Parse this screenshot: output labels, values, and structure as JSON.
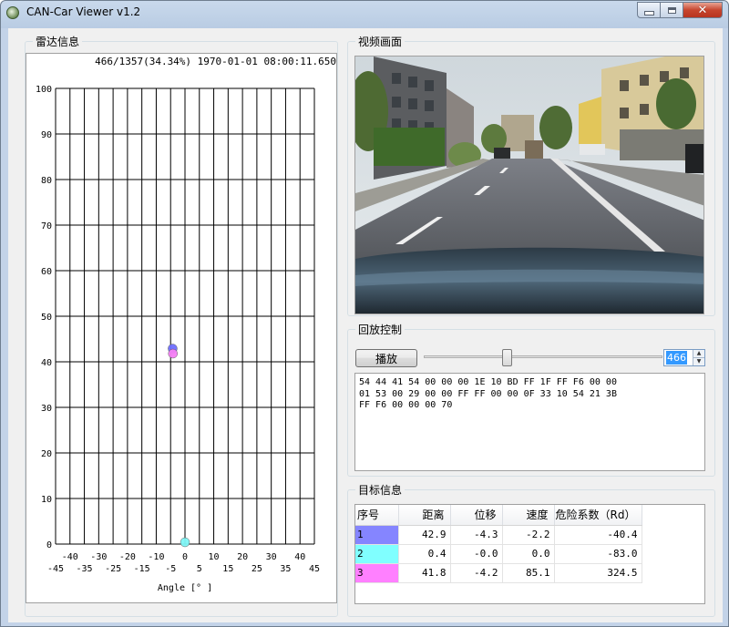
{
  "window": {
    "title": "CAN-Car Viewer v1.2",
    "controls": [
      "minimize",
      "maximize",
      "close"
    ]
  },
  "radar": {
    "group_label": "雷达信息",
    "info": "466/1357(34.34%) 1970-01-01 08:00:11.650",
    "chart_data": {
      "type": "scatter",
      "xlabel": "Angle [° ]",
      "ylabel": "",
      "xlim": [
        -45,
        45
      ],
      "ylim": [
        0,
        100
      ],
      "y_ticks": [
        "0",
        "10",
        "20",
        "30",
        "40",
        "50",
        "60",
        "70",
        "80",
        "90",
        "100"
      ],
      "x_ticks_top": [
        "-40",
        "-30",
        "-20",
        "-10",
        "0",
        "10",
        "20",
        "30",
        "40"
      ],
      "x_ticks_bottom": [
        "-45",
        "-35",
        "-25",
        "-15",
        "-5",
        "5",
        "15",
        "25",
        "35",
        "45"
      ],
      "grid": true,
      "points": [
        {
          "id": "1",
          "x": -4.3,
          "y": 42.9,
          "color": "#6f6fff"
        },
        {
          "id": "2",
          "x": 0.0,
          "y": 0.4,
          "color": "#7ff6f6"
        },
        {
          "id": "3",
          "x": -4.2,
          "y": 41.8,
          "color": "#f57ff5"
        }
      ]
    }
  },
  "video": {
    "group_label": "视频画面"
  },
  "playback": {
    "group_label": "回放控制",
    "play_label": "播放",
    "slider_position": 0.3434,
    "frame_value": "466",
    "hex_text": "54 44 41 54 00 00 00 1E 10 BD FF 1F FF F6 00 00\n01 53 00 29 00 00 FF FF 00 00 0F 33 10 54 21 3B\nFF F6 00 00 00 70"
  },
  "targets": {
    "group_label": "目标信息",
    "columns": [
      "序号",
      "距离",
      "位移",
      "速度",
      "危险系数（Rd）"
    ],
    "rows": [
      {
        "id": "1",
        "distance": "42.9",
        "displacement": "-4.3",
        "speed": "-2.2",
        "risk": "-40.4",
        "color": "#8585ff"
      },
      {
        "id": "2",
        "distance": "0.4",
        "displacement": "-0.0",
        "speed": "0.0",
        "risk": "-83.0",
        "color": "#80ffff"
      },
      {
        "id": "3",
        "distance": "41.8",
        "displacement": "-4.2",
        "speed": "85.1",
        "risk": "324.5",
        "color": "#ff80ff"
      }
    ]
  }
}
